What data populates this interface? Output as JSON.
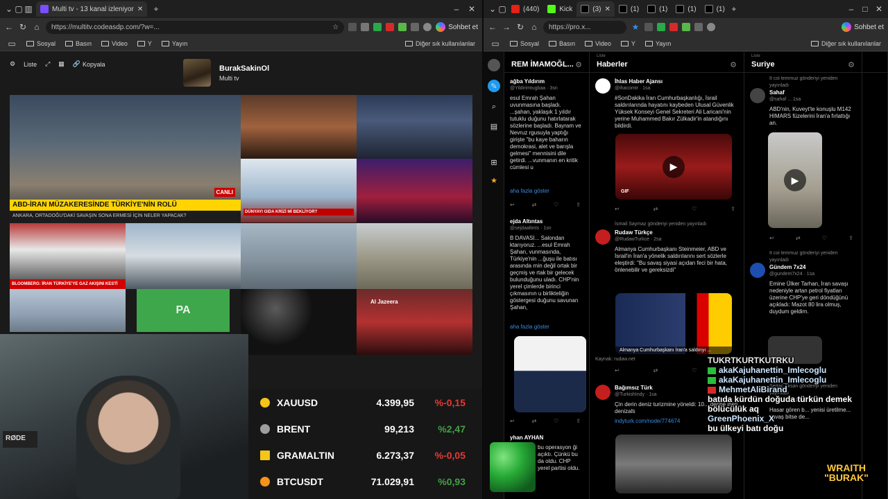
{
  "left_browser": {
    "active_tab": "Multi tv - 13 kanal izleniyor",
    "url": "https://multitv.codeasdp.com/?w=...",
    "copilot_label": "Sohbet et",
    "bookmarks": [
      "Sosyal",
      "Basın",
      "Video",
      "Y",
      "Yayın"
    ],
    "bookmarks_right": "Diğer sık kullanılanlar"
  },
  "multitv": {
    "controls": [
      "Liste",
      "Kopyala"
    ],
    "user_name": "BurakSakinOl",
    "user_sub": "Multi tv",
    "tiles": {
      "main_banner": "ABD-İRAN MÜZAKERESİNDE TÜRKİYE'NİN ROLÜ",
      "main_sub": "ANKARA, ORTADOĞU'DAKİ SAVAŞIN SONA ERMESİ İÇİN NELER YAPACAK?",
      "main_tag": "CANLI",
      "tile4_label": "DÜNYAYI GIDA KRİZİ Mİ BEKLİYOR?",
      "tile6_label": "BLOOMBERG: İRAN TÜRKİYE'YE GAZ AKIŞINI KESTİ",
      "tile11_label": "PA",
      "tile13_label": "Al Jazeera"
    }
  },
  "ticker": [
    {
      "symbol": "XAUUSD",
      "value": "4.399,95",
      "change": "%-0,15",
      "color": "#e53935",
      "icon_color": "#f5c518"
    },
    {
      "symbol": "BRENT",
      "value": "99,213",
      "change": "%2,47",
      "color": "#43a047",
      "icon_color": "#9e9e9e"
    },
    {
      "symbol": "GRAMALTIN",
      "value": "6.273,37",
      "change": "%-0,05",
      "color": "#e53935",
      "icon_color": "#f5c518"
    },
    {
      "symbol": "BTCUSDT",
      "value": "71.029,91",
      "change": "%0,93",
      "color": "#43a047",
      "icon_color": "#f7931a"
    }
  ],
  "right_browser": {
    "tabs": [
      "(440)",
      "Kick",
      "(3)",
      "(1)",
      "(1)",
      "(1)",
      "(1)"
    ],
    "url": "https://pro.x...",
    "copilot_label": "Sohbet et",
    "bookmarks": [
      "Sosyal",
      "Basın",
      "Video",
      "Y",
      "Yayın"
    ],
    "bookmarks_right": "Diğer sık kullanılanlar"
  },
  "deck": {
    "col1": {
      "title": "REM İMAMOĞL...",
      "tweets": [
        {
          "name": "ağba Yıldırım",
          "handle": "@Yildirimtugbaa · 3sn",
          "text": "esul Emrah Şahan uvunmasına başladı. ...şahan, yaklaşık 1 yıldır tutuklu duğunu hatırlatarak sözlerine başladı. Bayram ve Nevruz rgusuyla yaptığı girişte \"bu kaye baharın demokrasi, alet ve barışla gelmesi\" mennisini dile getirdi. ...vunmanın en kritik cümlesi u",
          "more": "aha fazla göster"
        },
        {
          "name": "ejda Altıntas",
          "handle": "@sejdaaltints · 1sn",
          "text": "B DAVASI... Salondan ktarıyoruz. ...esul Emrah Şahan, vunmasında, Türkiye'nin ...ğuşu ile batısı arasında rnin değil ortak bir geçmiş ve rtak bir gelecek bulunduğunu uladı. CHP'nin yerel çimlerde birinci çıkmasının u birlikteliğin göstergesi duğunu savunan Şahan,",
          "more": "aha fazla göster"
        },
        {
          "name": "yhan AYHAN",
          "handle": "",
          "text": "bu operasyon ği açıktı. Çünkü bu da oldu. CHP yerel partisi oldu.",
          "more": ""
        }
      ]
    },
    "col2": {
      "label": "Liste",
      "title": "Haberler",
      "tweets": [
        {
          "name": "İhlas Haber Ajansı",
          "handle": "@ihacomtr · 1sa",
          "text": "#SonDakika İran Cumhurbaşkanlığı, İsrail saldırılarında hayatını kaybeden Ulusal Güvenlik Yüksek Konseyi Genel Sekreteri Ali Laricani'nin yerine Muhammed Bakır Zülkadir'in atandığını bildirdi.",
          "badge": "GIF"
        },
        {
          "rt": "İsmail Saymaz gönderiyi yeniden yayınladı",
          "name": "Rudaw Türkçe",
          "handle": "@RudawTurkce · 2sa",
          "text": "Almanya Cumhurbaşkanı Steinmeier, ABD ve İsrail'in İran'a yönelik saldırılarını sert sözlerle eleştirdi: \"Bu savaş siyasi açıdan feci bir hata, önlenebilir ve gereksizdi\"",
          "caption": "Almanya Cumhurbaşkanı İran'a saldırıyı ...",
          "source": "Kaynak: rudaw.net"
        },
        {
          "name": "Bağımsız Türk",
          "handle": "@TurkishIndy · 1sa",
          "text": "Çin derin deniz turizmine yöneldi: 10... derine inen denizaltı",
          "link": "indyturk.com/node/774674"
        }
      ]
    },
    "col3": {
      "label": "Liste",
      "title": "Suriye",
      "tweets": [
        {
          "rt": "It coi temmuz gönderiyi yeniden yayınladı",
          "name": "Sahaf",
          "handle": "@sahaf ... 1sa",
          "text": "ABD'nin, Kuveyt'te konuşlu M142 HIMARS füzelerini İran'a fırlattığı an."
        },
        {
          "rt": "It coi temmuz gönderiyi yeniden yayınladı",
          "name": "Gündem 7x24",
          "handle": "@gundem7x24 · 1sa",
          "text": "Emine Ülker Tarhan, İran savaşı nedeniyle artan petrol fiyatları üzerine CHP'ye geri döndüğünü açıkladı: Mazot 80 lira olmuş, duydum geldim."
        },
        {
          "rt": "Sertac Aksan gönderiyi yeniden yayınladı",
          "name": "",
          "handle": "@trthaber · 1sa",
          "text": "Hasar gören b... yenisi üretilme... savaş bitse de..."
        }
      ]
    }
  },
  "chat": [
    {
      "user": "TUKRTKURTKUTRKU",
      "text": ""
    },
    {
      "user": "akaKajuhanettin_Imlecoglu",
      "text": ""
    },
    {
      "user": "akaKajuhanettin_Imlecoglu",
      "text": ""
    },
    {
      "user": "MehmetAliBirand",
      "text": "batıda kürdün doğuda türkün demek bölücülük aq"
    },
    {
      "user": "GreenPhoenix_X",
      "text": "bu ülkeyi batı doğu"
    }
  ],
  "overlay": {
    "brand_top": "WRAITH",
    "brand_bottom": "\"BURAK\""
  }
}
